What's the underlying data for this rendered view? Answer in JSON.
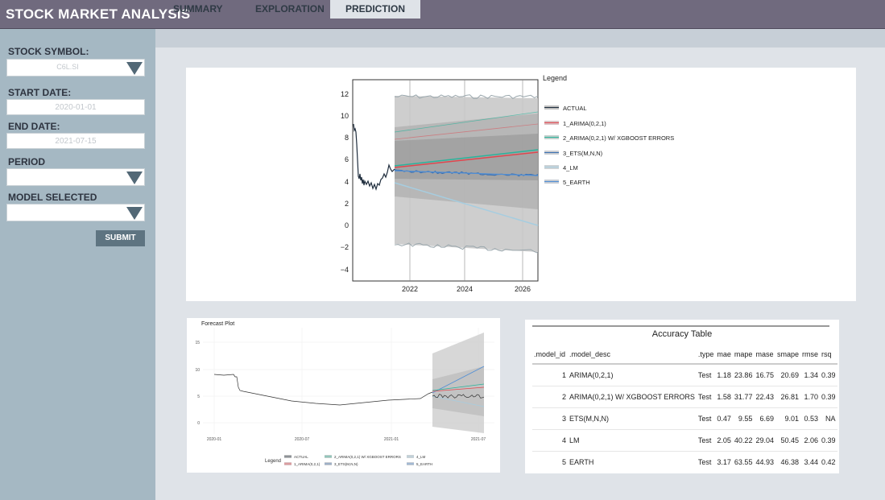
{
  "app": {
    "title": "STOCK MARKET ANALYSIS"
  },
  "tabs": [
    {
      "label": "SUMMARY"
    },
    {
      "label": "EXPLORATION"
    },
    {
      "label": "PREDICTION"
    }
  ],
  "sidebar": {
    "stock_symbol": {
      "label": "STOCK SYMBOL:",
      "value": "C6L.SI"
    },
    "start_date": {
      "label": "START DATE:",
      "value": "2020-01-01"
    },
    "end_date": {
      "label": "END DATE:",
      "value": "2021-07-15"
    },
    "period": {
      "label": "PERIOD",
      "value": ""
    },
    "model_selected": {
      "label": "MODEL SELECTED",
      "value": ""
    },
    "submit_label": "SUBMIT"
  },
  "main_chart": {
    "legend_title": "Legend",
    "legend": [
      "ACTUAL",
      "1_ARIMA(0,2,1)",
      "2_ARIMA(0,2,1) W/ XGBOOST ERRORS",
      "3_ETS(M,N,N)",
      "4_LM",
      "5_EARTH"
    ],
    "y_ticks": [
      "12",
      "10",
      "8",
      "6",
      "4",
      "2",
      "0",
      "−2",
      "−4"
    ],
    "x_ticks": [
      "2022",
      "2024",
      "2026"
    ]
  },
  "forecast_plot": {
    "title": "Forecast Plot",
    "y_ticks": [
      "15",
      "10",
      "5",
      "0"
    ],
    "x_ticks": [
      "2020-01",
      "2020-07",
      "2021-01",
      "2021-07"
    ],
    "legend_title": "Legend",
    "legend": [
      "ACTUAL",
      "1_ARIMA(0,2,1)",
      "2_ARIMA(0,2,1) W/ XGBOOST ERRORS",
      "3_ETS(M,N,N)",
      "4_LM",
      "5_EARTH"
    ]
  },
  "accuracy": {
    "title": "Accuracy Table",
    "columns": [
      ".model_id",
      ".model_desc",
      ".type",
      "mae",
      "mape",
      "mase",
      "smape",
      "rmse",
      "rsq"
    ],
    "rows": [
      [
        "1",
        "ARIMA(0,2,1)",
        "Test",
        "1.18",
        "23.86",
        "16.75",
        "20.69",
        "1.34",
        "0.39"
      ],
      [
        "2",
        "ARIMA(0,2,1) W/ XGBOOST ERRORS",
        "Test",
        "1.58",
        "31.77",
        "22.43",
        "26.81",
        "1.70",
        "0.39"
      ],
      [
        "3",
        "ETS(M,N,N)",
        "Test",
        "0.47",
        "9.55",
        "6.69",
        "9.01",
        "0.53",
        "NA"
      ],
      [
        "4",
        "LM",
        "Test",
        "2.05",
        "40.22",
        "29.04",
        "50.45",
        "2.06",
        "0.39"
      ],
      [
        "5",
        "EARTH",
        "Test",
        "3.17",
        "63.55",
        "44.93",
        "46.38",
        "3.44",
        "0.42"
      ]
    ]
  },
  "colors": {
    "header": "#706a7e",
    "sidebar": "#a5b8c3",
    "actual": "#1f2d3d",
    "arima": "#e0464e",
    "arima_xgb": "#2bb39b",
    "ets": "#3a6fb0",
    "lm": "#a6cde0",
    "earth": "#4f8ed6"
  }
}
